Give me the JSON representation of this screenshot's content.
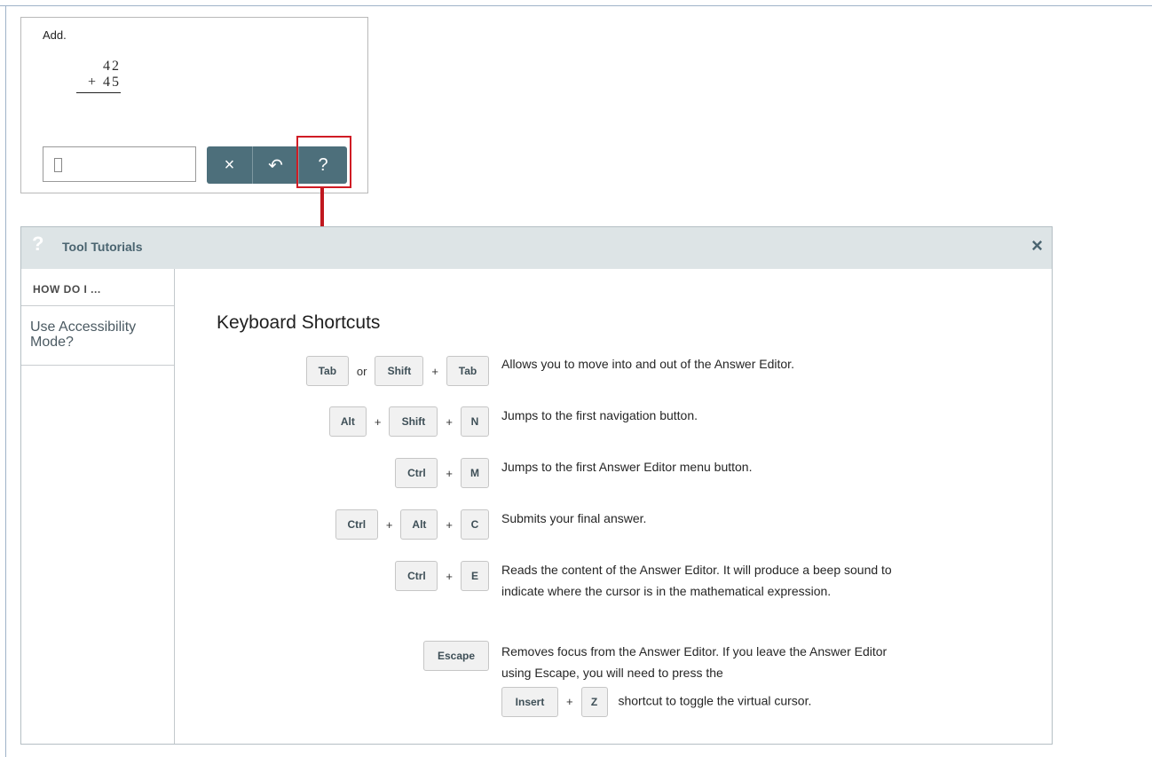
{
  "question": {
    "prompt": "Add.",
    "addend1": "42",
    "addend2": "+ 45",
    "toolbar": {
      "clear_icon": "×",
      "undo_icon": "↶",
      "help_icon": "?"
    }
  },
  "panel": {
    "title": "Tool Tutorials",
    "help_icon": "?",
    "close_icon": "×",
    "sidebar": {
      "header": "HOW DO I ...",
      "items": [
        "Use Accessibility Mode?"
      ]
    },
    "content_title": "Keyboard Shortcuts",
    "shortcuts": [
      {
        "keys": [
          "Tab",
          "or",
          "Shift",
          "+",
          "Tab"
        ],
        "desc": "Allows you to move into and out of the Answer Editor."
      },
      {
        "keys": [
          "Alt",
          "+",
          "Shift",
          "+",
          "N"
        ],
        "desc": "Jumps to the first navigation button."
      },
      {
        "keys": [
          "Ctrl",
          "+",
          "M"
        ],
        "desc": "Jumps to the first Answer Editor menu button."
      },
      {
        "keys": [
          "Ctrl",
          "+",
          "Alt",
          "+",
          "C"
        ],
        "desc": "Submits your final answer."
      },
      {
        "keys": [
          "Ctrl",
          "+",
          "E"
        ],
        "desc": "Reads the content of the Answer Editor. It will produce a beep sound to indicate where the cursor is in the mathematical expression."
      },
      {
        "keys": [
          "Escape"
        ],
        "desc_1": "Removes focus from the Answer Editor. If you leave the Answer Editor using Escape, you will need to press the",
        "inline_keys": [
          "Insert",
          "+",
          "Z"
        ],
        "desc_2": "shortcut to toggle the virtual cursor."
      }
    ]
  },
  "colors": {
    "highlight": "#d01c25",
    "button": "#4d6f7b",
    "header_bg": "#dde4e6"
  }
}
